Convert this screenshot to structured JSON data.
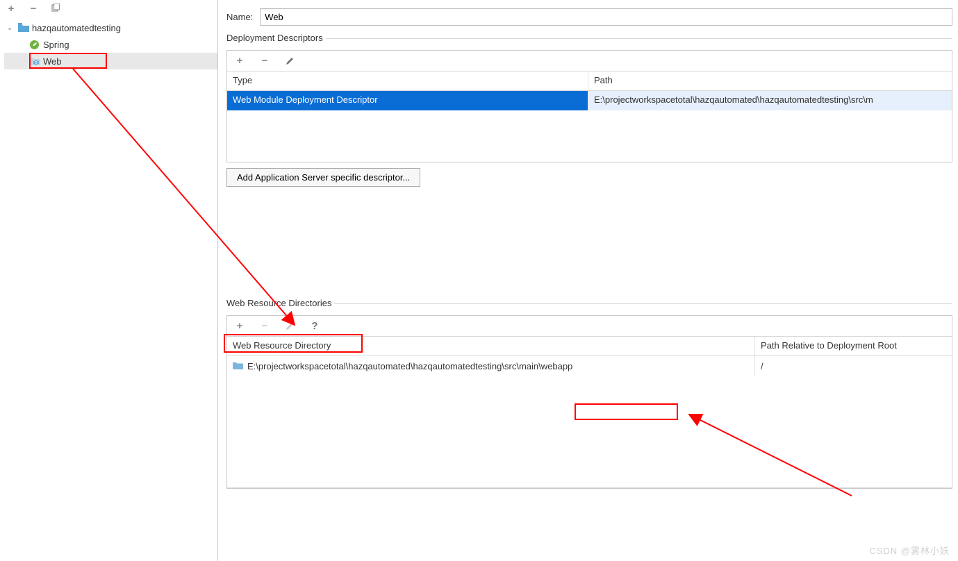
{
  "sidebar": {
    "root": "hazqautomatedtesting",
    "items": [
      "Spring",
      "Web"
    ]
  },
  "name": {
    "label": "Name:",
    "value": "Web"
  },
  "dd": {
    "title": "Deployment Descriptors",
    "col_type": "Type",
    "col_path": "Path",
    "rows": [
      {
        "type": "Web Module Deployment Descriptor",
        "path": "E:\\projectworkspacetotal\\hazqautomated\\hazqautomatedtesting\\src\\m"
      }
    ],
    "button": "Add Application Server specific descriptor..."
  },
  "wrd": {
    "title": "Web Resource Directories",
    "col_dir": "Web Resource Directory",
    "col_rel": "Path Relative to Deployment Root",
    "rows": [
      {
        "dir": "E:\\projectworkspacetotal\\hazqautomated\\hazqautomatedtesting\\src\\main\\webapp",
        "rel": "/"
      }
    ]
  },
  "watermark": "CSDN @雾林小妖"
}
